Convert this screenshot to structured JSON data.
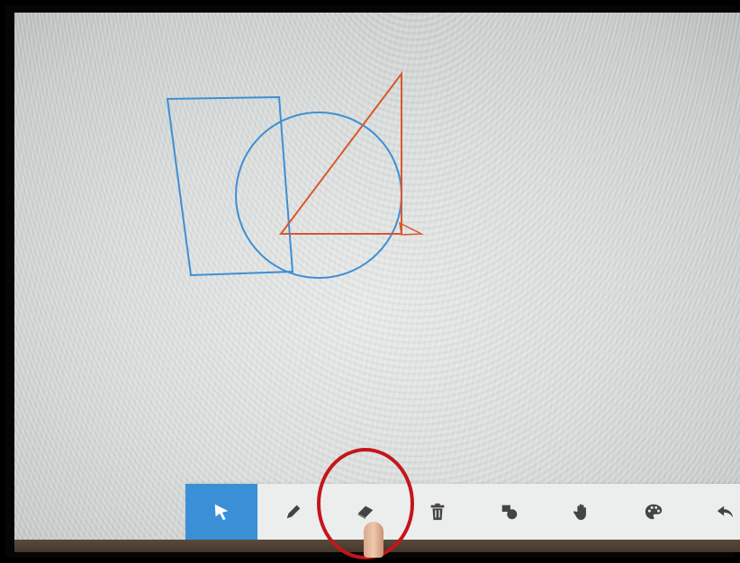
{
  "toolbar": {
    "tools": [
      {
        "name": "select-tool",
        "icon": "cursor-arrow-icon",
        "active": true
      },
      {
        "name": "pen-tool",
        "icon": "pencil-icon",
        "active": false
      },
      {
        "name": "eraser-tool",
        "icon": "eraser-icon",
        "active": false
      },
      {
        "name": "clear-tool",
        "icon": "trash-icon",
        "active": false
      },
      {
        "name": "shapes-tool",
        "icon": "shapes-icon",
        "active": false
      },
      {
        "name": "pan-tool",
        "icon": "hand-icon",
        "active": false
      },
      {
        "name": "color-tool",
        "icon": "palette-icon",
        "active": false
      },
      {
        "name": "undo-tool",
        "icon": "undo-arrow-icon",
        "active": false
      }
    ],
    "active_color": "#3a8fd6",
    "icon_color": "#444444",
    "active_icon_color": "#ffffff"
  },
  "drawing": {
    "blue_stroke": "#3f8fd2",
    "red_stroke": "#d9572e"
  },
  "annotation": {
    "highlight_color": "#c4161c",
    "highlighted_tool": "eraser-tool"
  }
}
